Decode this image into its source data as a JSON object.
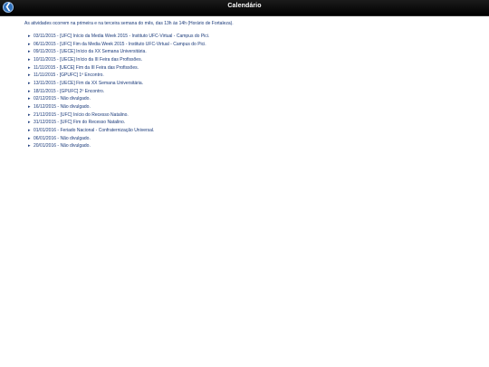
{
  "header": {
    "title": "Calendário",
    "back_glyph": "❮",
    "back_icon": "back-arrow-icon"
  },
  "intro": "As atividades ocorrem na primeira e na terceira semana do mês, das 13h às 14h (Horário de Fortaleza).",
  "colors": {
    "header_bg": "#000000",
    "text": "#1a3a7a",
    "back_button": "#2f6fb8"
  },
  "events": [
    {
      "date": "03/11/2015",
      "sep": " - ",
      "text": "[UFC] Início da Media Week 2015 - Instituto UFC-Virtual - Campus do Pici."
    },
    {
      "date": "06/11/2015",
      "sep": " - ",
      "text": "[UFC] Fim da Media Week 2015 - Instituto UFC-Virtual - Campus do Pici."
    },
    {
      "date": "09/11/2015",
      "sep": " - ",
      "text": "[UECE] Início da XX Semana Universitária."
    },
    {
      "date": "10/11/2015",
      "sep": " - ",
      "text": "[UECE] Início da III Feira das Profissões."
    },
    {
      "date": "11/11/2015",
      "sep": " - ",
      "text": "[UECE] Fim da III Feira das Profissões."
    },
    {
      "date": "11/11/2015",
      "sep": " - ",
      "text": "[GPUFC] 1º Encontro."
    },
    {
      "date": "13/11/2015",
      "sep": " - ",
      "text": "[UECE] Fim da XX Semana Universitária."
    },
    {
      "date": "18/11/2015",
      "sep": " - ",
      "text": "[GPUFC] 2º Encontro."
    },
    {
      "date": "02/12/2015",
      "sep": " - ",
      "text": "Não divulgado."
    },
    {
      "date": "16/12/2015",
      "sep": " - ",
      "text": "Não divulgado."
    },
    {
      "date": "21/12/2015",
      "sep": " - ",
      "text": "[UFC] Início do Recesso Natalino."
    },
    {
      "date": "31/12/2015",
      "sep": " - ",
      "text": "[UFC] Fim do Recesso Natalino."
    },
    {
      "date": "01/01/2016",
      "sep": " - ",
      "text": "Feriado Nacional - Confraternização Universal."
    },
    {
      "date": "06/01/2016",
      "sep": " - ",
      "text": "Não divulgado."
    },
    {
      "date": "20/01/2016",
      "sep": " - ",
      "text": "Não divulgado."
    }
  ]
}
